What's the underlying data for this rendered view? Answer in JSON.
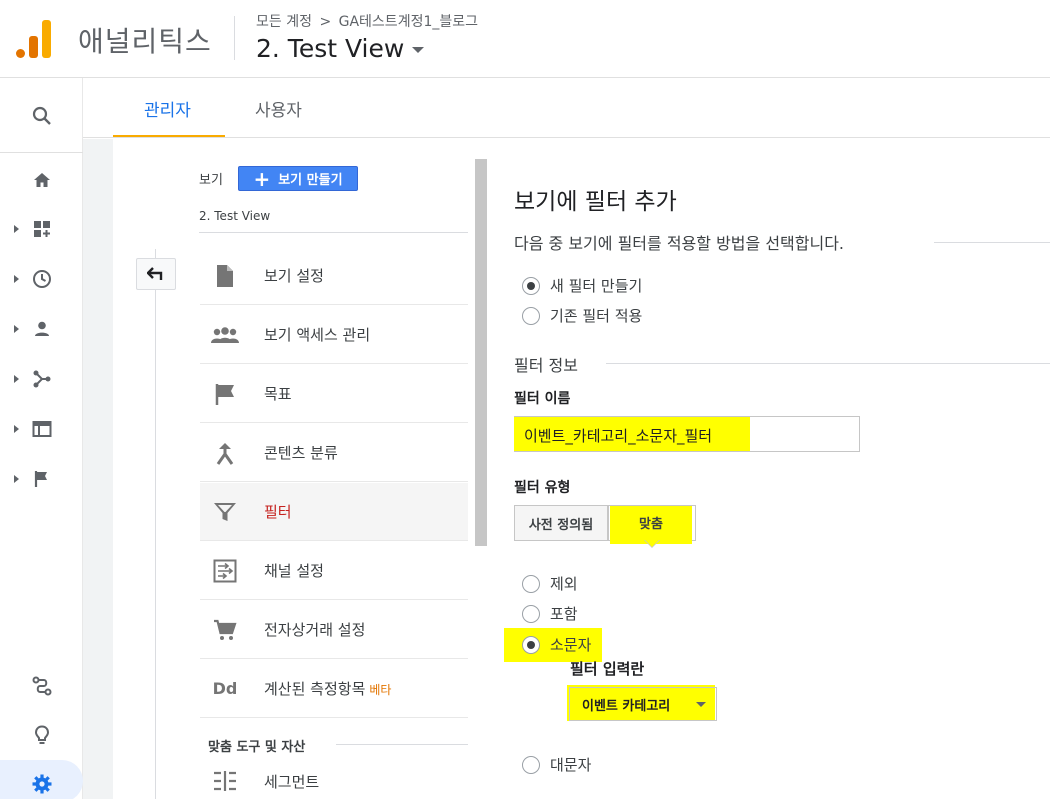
{
  "header": {
    "app_name": "애널리틱스",
    "breadcrumb_account": "모든 계정",
    "breadcrumb_separator": ">",
    "breadcrumb_property": "GA테스트계정1_블로그",
    "view_title": "2. Test View"
  },
  "tabs": [
    {
      "label": "관리자",
      "active": true
    },
    {
      "label": "사용자",
      "active": false
    }
  ],
  "view_column": {
    "label": "보기",
    "create_button": "보기 만들기",
    "current_view": "2. Test View",
    "menu": [
      {
        "label": "보기 설정",
        "icon": "document-icon"
      },
      {
        "label": "보기 액세스 관리",
        "icon": "people-icon"
      },
      {
        "label": "목표",
        "icon": "flag-icon"
      },
      {
        "label": "콘텐츠 분류",
        "icon": "merge-icon"
      },
      {
        "label": "필터",
        "icon": "filter-icon",
        "active": true
      },
      {
        "label": "채널 설정",
        "icon": "channel-icon"
      },
      {
        "label": "전자상거래 설정",
        "icon": "cart-icon"
      },
      {
        "label": "계산된 측정항목",
        "icon": "dd-icon",
        "badge": "베타"
      }
    ],
    "section_label": "맞춤 도구 및 자산",
    "segment_item": "세그먼트",
    "dd_text": "Dd"
  },
  "panel": {
    "title": "보기에 필터 추가",
    "subtitle": "다음 중 보기에 필터를 적용할 방법을 선택합니다.",
    "method_options": [
      {
        "label": "새 필터 만들기",
        "selected": true
      },
      {
        "label": "기존 필터 적용",
        "selected": false
      }
    ],
    "section_head": "필터 정보",
    "filter_name_label": "필터 이름",
    "filter_name_value": "이벤트_카테고리_소문자_필터",
    "filter_type_label": "필터 유형",
    "type_tabs": [
      "사전 정의됨",
      "맞춤"
    ],
    "custom_options": [
      {
        "label": "제외",
        "selected": false
      },
      {
        "label": "포함",
        "selected": false
      },
      {
        "label": "소문자",
        "selected": true
      },
      {
        "label": "대문자",
        "selected": false
      }
    ],
    "filter_field_label": "필터 입력란",
    "filter_field_value": "이벤트 카테고리"
  },
  "colors": {
    "accent": "#1a73e8",
    "tab_underline": "#f9ab00",
    "highlight": "#ffff00",
    "active_menu_text": "#c5221f",
    "create_button": "#4285f4"
  }
}
